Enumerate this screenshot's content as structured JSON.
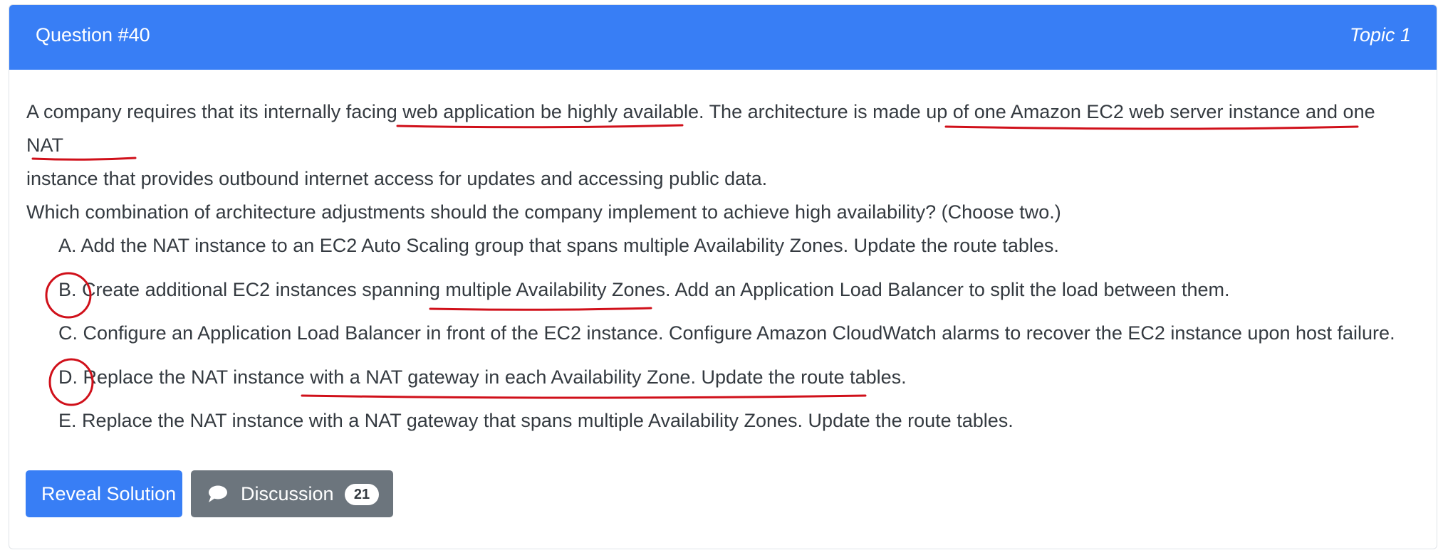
{
  "header": {
    "question_title": "Question #40",
    "topic": "Topic 1"
  },
  "question": {
    "line1": "A company requires that its internally facing web application be highly available. The architecture is made up of one Amazon EC2 web server instance and one NAT",
    "line2": "instance that provides outbound internet access for updates and accessing public data.",
    "line3": "Which combination of architecture adjustments should the company implement to achieve high availability? (Choose two.)"
  },
  "choices": [
    {
      "letter": "A.",
      "text": "Add the NAT instance to an EC2 Auto Scaling group that spans multiple Availability Zones. Update the route tables."
    },
    {
      "letter": "B.",
      "text": "Create additional EC2 instances spanning multiple Availability Zones. Add an Application Load Balancer to split the load between them."
    },
    {
      "letter": "C.",
      "text": "Configure an Application Load Balancer in front of the EC2 instance. Configure Amazon CloudWatch alarms to recover the EC2 instance upon host failure."
    },
    {
      "letter": "D.",
      "text": "Replace the NAT instance with a NAT gateway in each Availability Zone. Update the route tables."
    },
    {
      "letter": "E.",
      "text": "Replace the NAT instance with a NAT gateway that spans multiple Availability Zones. Update the route tables."
    }
  ],
  "buttons": {
    "reveal_label": "Reveal Solution",
    "discussion_label": "Discussion",
    "discussion_count": "21",
    "discussion_icon": "chat-bubble-icon"
  },
  "annotations": {
    "color": "#d0101a",
    "circled_choices": [
      "B.",
      "D."
    ]
  },
  "colors": {
    "header_bg": "#387ef5",
    "reveal_bg": "#387ef5",
    "discussion_bg": "#6c757d",
    "text": "#343a40"
  }
}
